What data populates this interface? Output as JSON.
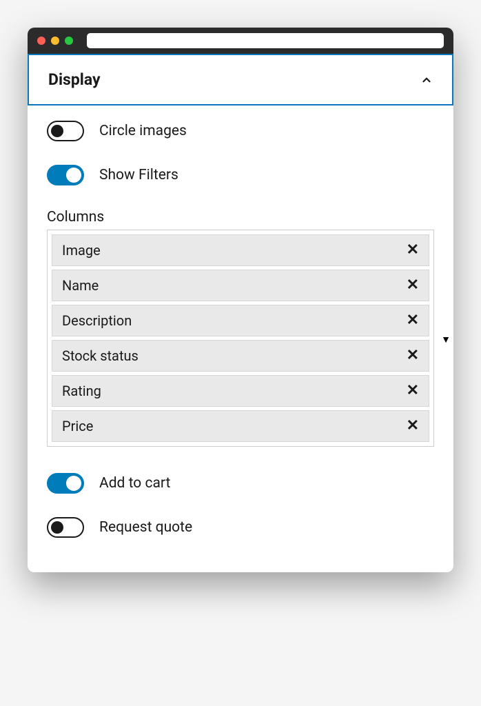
{
  "accordion": {
    "title": "Display"
  },
  "toggles": {
    "circle_images": {
      "label": "Circle images",
      "on": false
    },
    "show_filters": {
      "label": "Show Filters",
      "on": true
    },
    "add_to_cart": {
      "label": "Add to cart",
      "on": true
    },
    "request_quote": {
      "label": "Request quote",
      "on": false
    }
  },
  "columns": {
    "label": "Columns",
    "items": [
      "Image",
      "Name",
      "Description",
      "Stock status",
      "Rating",
      "Price"
    ]
  }
}
